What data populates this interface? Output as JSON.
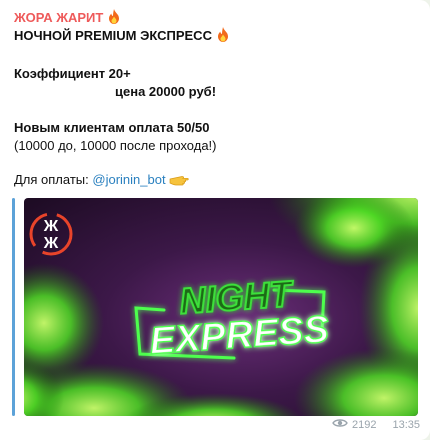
{
  "post": {
    "channel_name": "ЖОРА ЖАРИТ",
    "line1": "НОЧНОЙ PREMIUM ЭКСПРЕСС",
    "coef": "Коэффициент 20+",
    "price": "цена 20000 руб!",
    "promo": "Новым клиентам оплата 50/50",
    "promo_detail": "(10000 до, 10000 после прохода!)",
    "pay_label": "Для оплаты:",
    "bot_link": "@jorinin_bot"
  },
  "banner": {
    "logo_letters": "ЖЖ",
    "title_line1": "NIGHT",
    "title_line2": "EXPRESS"
  },
  "footer": {
    "views": "2192",
    "time": "13:35"
  },
  "colors": {
    "channel_name": "#ee5a5a",
    "link": "#2a80bf",
    "neon_green": "#4dff4d",
    "banner_purple": "#6b2e7a"
  },
  "icons": [
    "fire-icon",
    "pointing-hand-icon",
    "eye-icon"
  ]
}
